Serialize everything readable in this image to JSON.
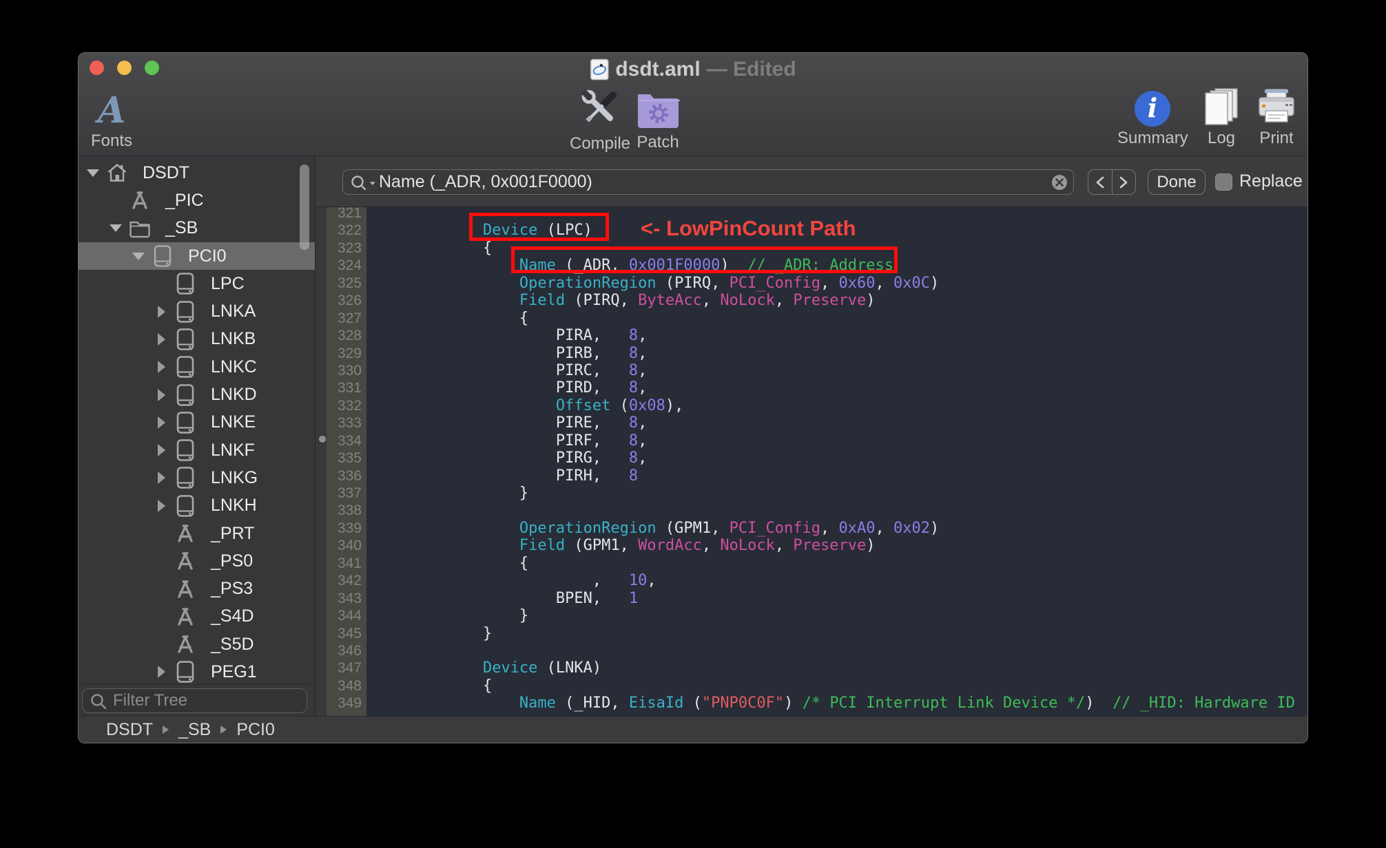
{
  "window": {
    "title_name": "dsdt.aml",
    "title_status": "— Edited"
  },
  "toolbar": {
    "fonts_label": "Fonts",
    "compile_label": "Compile",
    "patch_label": "Patch",
    "summary_label": "Summary",
    "log_label": "Log",
    "print_label": "Print"
  },
  "sidebar": {
    "filter_placeholder": "Filter Tree",
    "items": [
      {
        "label": "DSDT",
        "icon": "home",
        "level": 0,
        "disclosure": "open",
        "selected": false
      },
      {
        "label": "_PIC",
        "icon": "method",
        "level": 1,
        "disclosure": "none",
        "selected": false
      },
      {
        "label": "_SB",
        "icon": "folder",
        "level": 1,
        "disclosure": "open",
        "selected": false
      },
      {
        "label": "PCI0",
        "icon": "device",
        "level": 2,
        "disclosure": "open",
        "selected": true
      },
      {
        "label": "LPC",
        "icon": "device",
        "level": 3,
        "disclosure": "none",
        "selected": false
      },
      {
        "label": "LNKA",
        "icon": "device",
        "level": 3,
        "disclosure": "closed",
        "selected": false
      },
      {
        "label": "LNKB",
        "icon": "device",
        "level": 3,
        "disclosure": "closed",
        "selected": false
      },
      {
        "label": "LNKC",
        "icon": "device",
        "level": 3,
        "disclosure": "closed",
        "selected": false
      },
      {
        "label": "LNKD",
        "icon": "device",
        "level": 3,
        "disclosure": "closed",
        "selected": false
      },
      {
        "label": "LNKE",
        "icon": "device",
        "level": 3,
        "disclosure": "closed",
        "selected": false
      },
      {
        "label": "LNKF",
        "icon": "device",
        "level": 3,
        "disclosure": "closed",
        "selected": false
      },
      {
        "label": "LNKG",
        "icon": "device",
        "level": 3,
        "disclosure": "closed",
        "selected": false
      },
      {
        "label": "LNKH",
        "icon": "device",
        "level": 3,
        "disclosure": "closed",
        "selected": false
      },
      {
        "label": "_PRT",
        "icon": "method",
        "level": 3,
        "disclosure": "none",
        "selected": false
      },
      {
        "label": "_PS0",
        "icon": "method",
        "level": 3,
        "disclosure": "none",
        "selected": false
      },
      {
        "label": "_PS3",
        "icon": "method",
        "level": 3,
        "disclosure": "none",
        "selected": false
      },
      {
        "label": "_S4D",
        "icon": "method",
        "level": 3,
        "disclosure": "none",
        "selected": false
      },
      {
        "label": "_S5D",
        "icon": "method",
        "level": 3,
        "disclosure": "none",
        "selected": false
      },
      {
        "label": "PEG1",
        "icon": "device",
        "level": 3,
        "disclosure": "closed",
        "selected": false
      }
    ]
  },
  "breadcrumb": {
    "items": [
      "DSDT",
      "_SB",
      "PCI0"
    ]
  },
  "search": {
    "value": "Name (_ADR, 0x001F0000)",
    "done_label": "Done",
    "replace_label": "Replace"
  },
  "annotation": {
    "text": "<- LowPinCount Path"
  },
  "colors": {
    "keyword": "#3ab1c5",
    "number": "#8b7fe8",
    "predefined": "#cf4f9f",
    "comment": "#3fbb57",
    "string": "#e25b5e",
    "annotation": "#fb0d0d",
    "annotation_text": "#f2453d",
    "editor_bg": "#272c37",
    "selection_bg": "#6a6a6c"
  },
  "editor": {
    "lines": [
      {
        "n": 321,
        "s": []
      },
      {
        "n": 322,
        "s": [
          [
            "pl",
            "            "
          ],
          [
            "kw",
            "Device"
          ],
          [
            "pl",
            " (LPC)"
          ]
        ]
      },
      {
        "n": 323,
        "s": [
          [
            "pl",
            "            {"
          ]
        ]
      },
      {
        "n": 324,
        "s": [
          [
            "pl",
            "                "
          ],
          [
            "kw",
            "Name"
          ],
          [
            "pl",
            " (_ADR, "
          ],
          [
            "num",
            "0x001F0000"
          ],
          [
            "pl",
            ")  "
          ],
          [
            "com",
            "// _ADR: Address"
          ]
        ]
      },
      {
        "n": 325,
        "s": [
          [
            "pl",
            "                "
          ],
          [
            "kw",
            "OperationRegion"
          ],
          [
            "pl",
            " (PIRQ, "
          ],
          [
            "const",
            "PCI_Config"
          ],
          [
            "pl",
            ", "
          ],
          [
            "num",
            "0x60"
          ],
          [
            "pl",
            ", "
          ],
          [
            "num",
            "0x0C"
          ],
          [
            "pl",
            ")"
          ]
        ]
      },
      {
        "n": 326,
        "s": [
          [
            "pl",
            "                "
          ],
          [
            "kw",
            "Field"
          ],
          [
            "pl",
            " (PIRQ, "
          ],
          [
            "const",
            "ByteAcc"
          ],
          [
            "pl",
            ", "
          ],
          [
            "const",
            "NoLock"
          ],
          [
            "pl",
            ", "
          ],
          [
            "const",
            "Preserve"
          ],
          [
            "pl",
            ")"
          ]
        ]
      },
      {
        "n": 327,
        "s": [
          [
            "pl",
            "                {"
          ]
        ]
      },
      {
        "n": 328,
        "s": [
          [
            "pl",
            "                    PIRA,   "
          ],
          [
            "num",
            "8"
          ],
          [
            "pl",
            ","
          ]
        ]
      },
      {
        "n": 329,
        "s": [
          [
            "pl",
            "                    PIRB,   "
          ],
          [
            "num",
            "8"
          ],
          [
            "pl",
            ","
          ]
        ]
      },
      {
        "n": 330,
        "s": [
          [
            "pl",
            "                    PIRC,   "
          ],
          [
            "num",
            "8"
          ],
          [
            "pl",
            ","
          ]
        ]
      },
      {
        "n": 331,
        "s": [
          [
            "pl",
            "                    PIRD,   "
          ],
          [
            "num",
            "8"
          ],
          [
            "pl",
            ","
          ]
        ]
      },
      {
        "n": 332,
        "s": [
          [
            "pl",
            "                    "
          ],
          [
            "kw",
            "Offset"
          ],
          [
            "pl",
            " ("
          ],
          [
            "num",
            "0x08"
          ],
          [
            "pl",
            "),"
          ]
        ]
      },
      {
        "n": 333,
        "s": [
          [
            "pl",
            "                    PIRE,   "
          ],
          [
            "num",
            "8"
          ],
          [
            "pl",
            ","
          ]
        ]
      },
      {
        "n": 334,
        "s": [
          [
            "pl",
            "                    PIRF,   "
          ],
          [
            "num",
            "8"
          ],
          [
            "pl",
            ","
          ]
        ]
      },
      {
        "n": 335,
        "s": [
          [
            "pl",
            "                    PIRG,   "
          ],
          [
            "num",
            "8"
          ],
          [
            "pl",
            ","
          ]
        ]
      },
      {
        "n": 336,
        "s": [
          [
            "pl",
            "                    PIRH,   "
          ],
          [
            "num",
            "8"
          ]
        ]
      },
      {
        "n": 337,
        "s": [
          [
            "pl",
            "                }"
          ]
        ]
      },
      {
        "n": 338,
        "s": []
      },
      {
        "n": 339,
        "s": [
          [
            "pl",
            "                "
          ],
          [
            "kw",
            "OperationRegion"
          ],
          [
            "pl",
            " (GPM1, "
          ],
          [
            "const",
            "PCI_Config"
          ],
          [
            "pl",
            ", "
          ],
          [
            "num",
            "0xA0"
          ],
          [
            "pl",
            ", "
          ],
          [
            "num",
            "0x02"
          ],
          [
            "pl",
            ")"
          ]
        ]
      },
      {
        "n": 340,
        "s": [
          [
            "pl",
            "                "
          ],
          [
            "kw",
            "Field"
          ],
          [
            "pl",
            " (GPM1, "
          ],
          [
            "const",
            "WordAcc"
          ],
          [
            "pl",
            ", "
          ],
          [
            "const",
            "NoLock"
          ],
          [
            "pl",
            ", "
          ],
          [
            "const",
            "Preserve"
          ],
          [
            "pl",
            ")"
          ]
        ]
      },
      {
        "n": 341,
        "s": [
          [
            "pl",
            "                {"
          ]
        ]
      },
      {
        "n": 342,
        "s": [
          [
            "pl",
            "                        ,   "
          ],
          [
            "num",
            "10"
          ],
          [
            "pl",
            ","
          ]
        ]
      },
      {
        "n": 343,
        "s": [
          [
            "pl",
            "                    BPEN,   "
          ],
          [
            "num",
            "1"
          ]
        ]
      },
      {
        "n": 344,
        "s": [
          [
            "pl",
            "                }"
          ]
        ]
      },
      {
        "n": 345,
        "s": [
          [
            "pl",
            "            }"
          ]
        ]
      },
      {
        "n": 346,
        "s": []
      },
      {
        "n": 347,
        "s": [
          [
            "pl",
            "            "
          ],
          [
            "kw",
            "Device"
          ],
          [
            "pl",
            " (LNKA)"
          ]
        ]
      },
      {
        "n": 348,
        "s": [
          [
            "pl",
            "            {"
          ]
        ]
      },
      {
        "n": 349,
        "s": [
          [
            "pl",
            "                "
          ],
          [
            "kw",
            "Name"
          ],
          [
            "pl",
            " (_HID, "
          ],
          [
            "kw",
            "EisaId"
          ],
          [
            "pl",
            " ("
          ],
          [
            "str",
            "\"PNP0C0F\""
          ],
          [
            "pl",
            ") "
          ],
          [
            "com",
            "/* PCI Interrupt Link Device */"
          ],
          [
            "pl",
            ")  "
          ],
          [
            "com",
            "// _HID: Hardware ID"
          ]
        ]
      }
    ]
  }
}
